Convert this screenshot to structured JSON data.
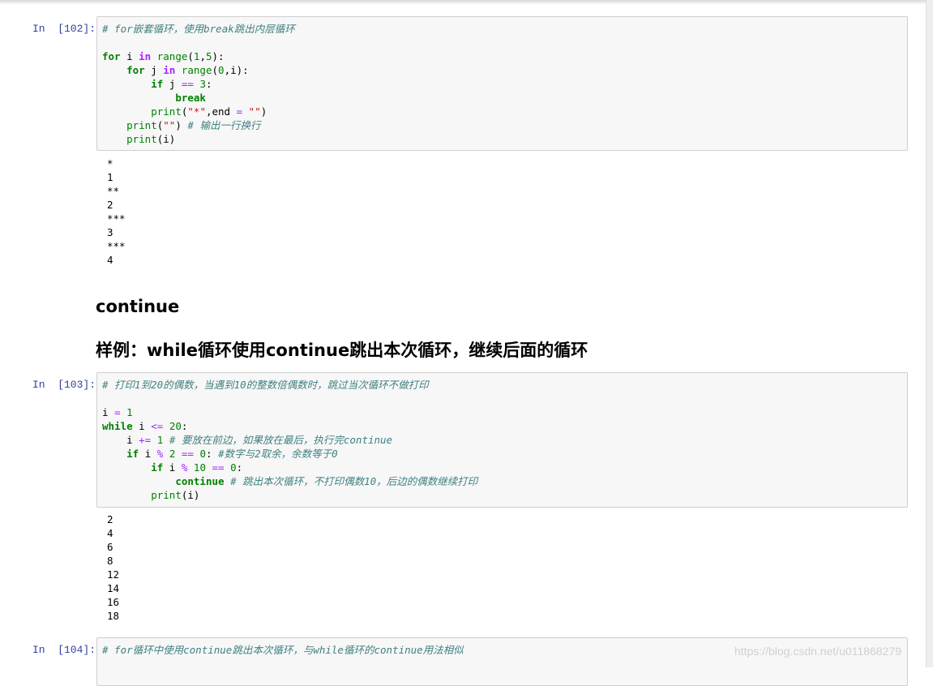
{
  "cells": [
    {
      "prompt": "In  [102]:",
      "code": [
        "# for嵌套循环，使用break跳出内层循环",
        "",
        "for i in range(1,5):",
        "    for j in range(0,i):",
        "        if j == 3:",
        "            break",
        "        print(\"*\",end = \"\")",
        "    print(\"\") # 输出一行换行",
        "    print(i)"
      ],
      "output": [
        "*",
        "1",
        "**",
        "2",
        "***",
        "3",
        "***",
        "4"
      ]
    },
    {
      "prompt": "In  [103]:",
      "code": [
        "# 打印1到20的偶数，当遇到10的整数倍偶数时，跳过当次循环不做打印",
        "",
        "i = 1",
        "while i <= 20:",
        "    i += 1 # 要放在前边，如果放在最后，执行完continue",
        "    if i % 2 == 0: #数字与2取余，余数等于0",
        "        if i % 10 == 0:",
        "            continue # 跳出本次循环，不打印偶数10，后边的偶数继续打印",
        "        print(i)"
      ],
      "output": [
        "2",
        "4",
        "6",
        "8",
        "12",
        "14",
        "16",
        "18"
      ]
    },
    {
      "prompt": "In  [104]:",
      "code": [
        "# for循环中使用continue跳出本次循环，与while循环的continue用法相似"
      ]
    }
  ],
  "markdown": {
    "heading1": "continue",
    "heading2": "样例：while循环使用continue跳出本次循环，继续后面的循环"
  },
  "watermark": "https://blog.csdn.net/u011868279"
}
